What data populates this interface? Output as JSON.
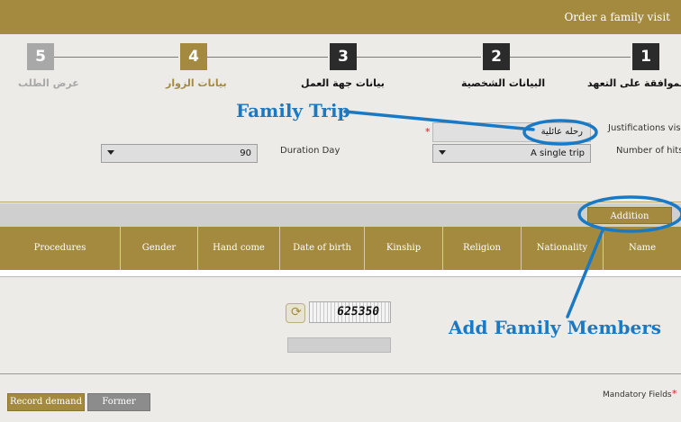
{
  "header": {
    "title": "Order a family visit"
  },
  "steps": [
    {
      "number": "1",
      "label": "الموافقة على التعهد"
    },
    {
      "number": "2",
      "label": "البيانات الشخصية"
    },
    {
      "number": "3",
      "label": "بيانات جهة العمل"
    },
    {
      "number": "4",
      "label": "بيانات الزوار"
    },
    {
      "number": "5",
      "label": "عرض الطلب"
    }
  ],
  "colors": {
    "gold": "#a38a3f",
    "dark": "#2b2b2b",
    "inactive": "#a8a8a8",
    "callout": "#1a79c4"
  },
  "form": {
    "justifications_label": "Justifications visit",
    "justifications_value": "رحله عائلية",
    "required_mark": "*",
    "number_of_hits_label": "Number of hits",
    "number_of_hits_value": "A single trip",
    "duration_label": "Duration Day",
    "duration_value": "90"
  },
  "addition_button": "Addition",
  "table": {
    "columns": [
      "Name",
      "Nationality",
      "Religion",
      "Kinship",
      "Date of birth",
      "Hand come",
      "Gender",
      "Procedures"
    ]
  },
  "captcha": {
    "code": "625350",
    "refresh_icon": "refresh-icon"
  },
  "footer": {
    "record_button": "Record demand",
    "former_button": "Former",
    "mandatory_label": "Mandatory Fields",
    "mandatory_mark": "*"
  },
  "annotations": {
    "family_trip": "Family Trip",
    "add_members": "Add Family Members"
  }
}
